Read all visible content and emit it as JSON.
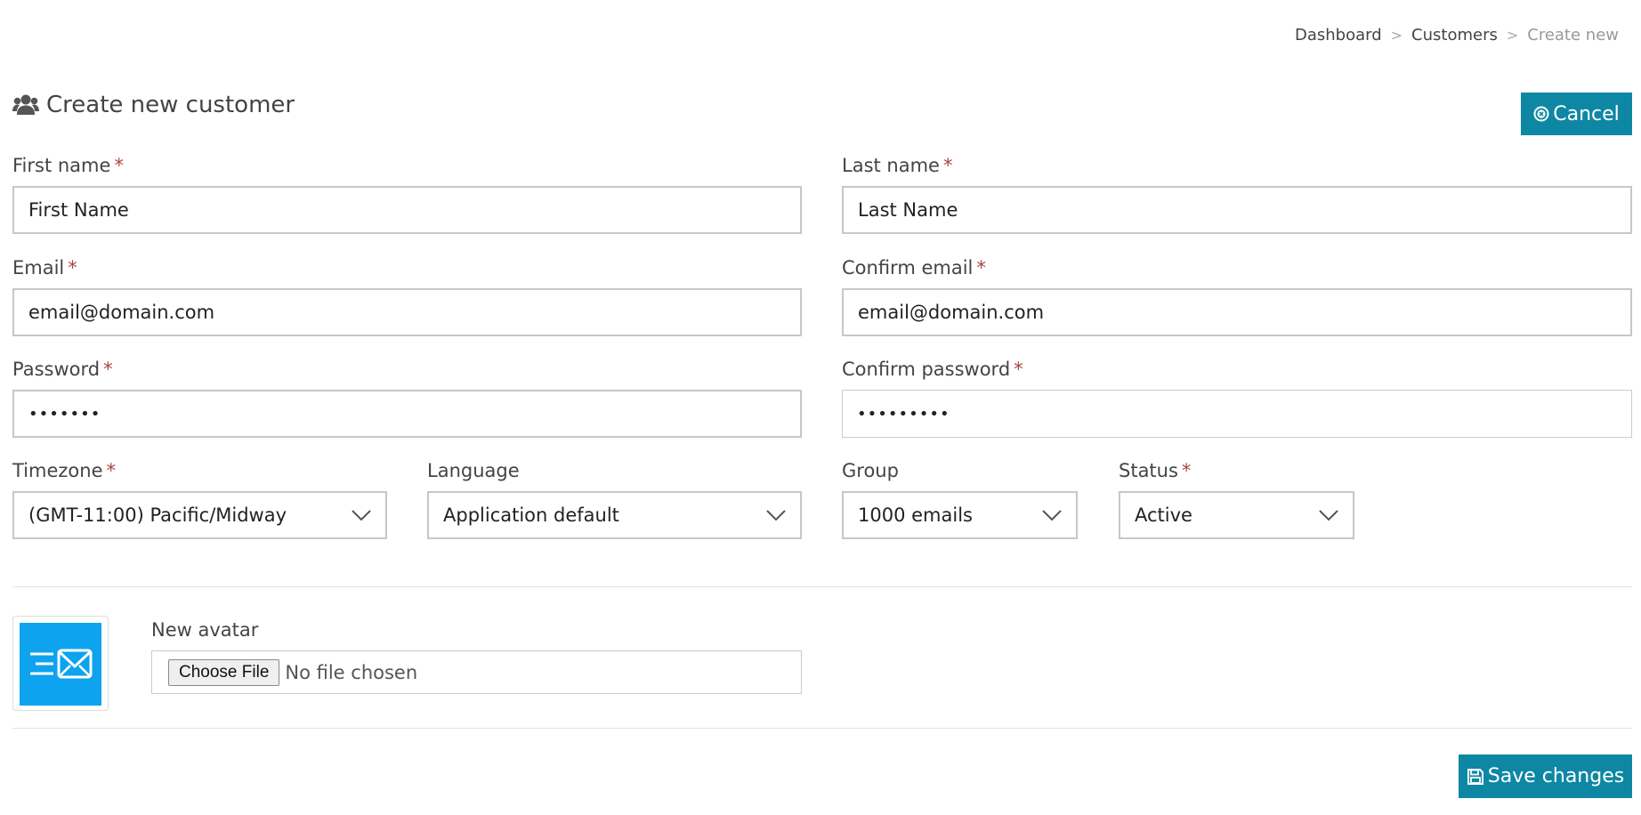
{
  "breadcrumb": {
    "items": [
      "Dashboard",
      "Customers",
      "Create new"
    ],
    "separator": ">"
  },
  "page": {
    "title": "Create new customer",
    "icon": "users-icon"
  },
  "buttons": {
    "cancel": "Cancel",
    "cancel_icon": "times-circle-icon",
    "save": "Save changes",
    "save_icon": "floppy-disk-icon"
  },
  "required_marker": "*",
  "form": {
    "first_name": {
      "label": "First name",
      "value": "First Name"
    },
    "last_name": {
      "label": "Last name",
      "value": "Last Name"
    },
    "email": {
      "label": "Email",
      "value": "email@domain.com"
    },
    "confirm_email": {
      "label": "Confirm email",
      "value": "email@domain.com"
    },
    "password": {
      "label": "Password",
      "value": "•••••••"
    },
    "confirm_password": {
      "label": "Confirm password",
      "value": "•••••••••"
    },
    "timezone": {
      "label": "Timezone",
      "value": "(GMT-11:00) Pacific/Midway"
    },
    "language": {
      "label": "Language",
      "value": "Application default"
    },
    "group": {
      "label": "Group",
      "value": "1000 emails"
    },
    "status": {
      "label": "Status",
      "value": "Active"
    }
  },
  "avatar": {
    "label": "New avatar",
    "choose_button": "Choose File",
    "file_status": "No file chosen",
    "image_icon": "email-fast-icon"
  },
  "colors": {
    "primary_button": "#0e87a4",
    "required": "#a94442",
    "avatar_bg": "#0da3ee"
  }
}
